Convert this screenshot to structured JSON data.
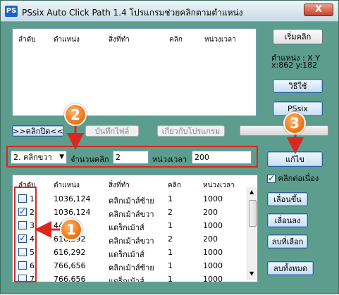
{
  "window": {
    "app_icon": "PS",
    "title": "PSsix Auto Click Path 1.4 โปรแกรมช่วยคลิกตามตำแหน่ง",
    "close_label": "X"
  },
  "top_list": {
    "headers": [
      "ลำดับ",
      "ตำแหน่ง",
      "สิ่งที่ทำ",
      "คลิก",
      "หน่วงเวลา"
    ]
  },
  "right_panel": {
    "start_button": "เริ่มคลิก",
    "position_label": "ตำแหน่ง : X Y",
    "position_value": "x:862 y:182",
    "howto_button": "วิธีใช้",
    "pssix_button": "PSsix",
    "edit_button": "แก้ไข",
    "continuous_click_label": "คลิกต่อเนื่อง",
    "continuous_click_checked": true
  },
  "toolbar": {
    "click_off_button": ">>คลิกปิด<<",
    "save_file_button": "บันทึกไฟล์",
    "about_button": "เกี่ยวกับโปรแกรม",
    "progress_fraction": 0
  },
  "edit_row": {
    "action_select": "2. คลิกขวา",
    "click_count_label": "จำนวนคลิก",
    "click_count_value": "2",
    "delay_label": "หน่วงเวลา",
    "delay_value": "200"
  },
  "bottom_list": {
    "headers": [
      "ลำดับ",
      "ตำแหน่ง",
      "สิ่งที่ทำ",
      "คลิก",
      "หน่วงเวลา"
    ],
    "rows": [
      {
        "checked": false,
        "index": "1",
        "position": "1036,124",
        "action": "คลิกเม้าส์ซ้าย",
        "clicks": "1",
        "delay": "1000"
      },
      {
        "checked": true,
        "index": "2",
        "position": "1036,124",
        "action": "คลิกเม้าส์ขวา",
        "clicks": "2",
        "delay": "200"
      },
      {
        "checked": false,
        "index": "3",
        "position": "44",
        "action": "แดร็กเม้าส์",
        "clicks": "1",
        "delay": "1000"
      },
      {
        "checked": true,
        "index": "4",
        "position": "616,292",
        "action": "คลิกเม้าส์ขวา",
        "clicks": "2",
        "delay": "200"
      },
      {
        "checked": false,
        "index": "5",
        "position": "616,292",
        "action": "แดร็กเม้าส์",
        "clicks": "1",
        "delay": "1000"
      },
      {
        "checked": false,
        "index": "6",
        "position": "766,656",
        "action": "คลิกเม้าส์ซ้าย",
        "clicks": "1",
        "delay": "1000"
      },
      {
        "checked": false,
        "index": "7",
        "position": "766,656",
        "action": "แดร็กเม้าส์",
        "clicks": "1",
        "delay": "1000"
      }
    ]
  },
  "side_buttons": {
    "move_up": "เลื่อนขึ้น",
    "move_down": "เลื่อนลง",
    "delete_selected": "ลบที่เลือก",
    "delete_all": "ลบทั้งหมด"
  },
  "annotations": {
    "badge_1": "1",
    "badge_2": "2",
    "badge_3": "3",
    "color": "#ef7a1a",
    "arrow_color": "#d8281f"
  }
}
